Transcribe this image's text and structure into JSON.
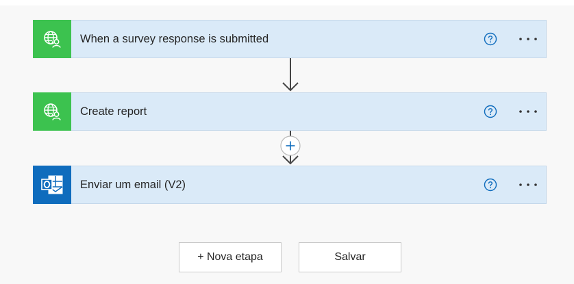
{
  "steps": [
    {
      "title": "When a survey response is submitted",
      "icon": "globe-person-icon",
      "color": "#3cc24f"
    },
    {
      "title": "Create report",
      "icon": "globe-person-icon",
      "color": "#3cc24f"
    },
    {
      "title": "Enviar um email (V2)",
      "icon": "outlook-icon",
      "color": "#0f6cbd"
    }
  ],
  "buttons": {
    "new_step": "+ Nova etapa",
    "save": "Salvar"
  },
  "colors": {
    "card_bg": "#daeaf8",
    "accent_blue": "#0f6cbd",
    "connector": "#444444"
  },
  "icons": {
    "help": "question-circle-icon",
    "more": "ellipsis-icon",
    "insert": "plus-circle-icon"
  }
}
